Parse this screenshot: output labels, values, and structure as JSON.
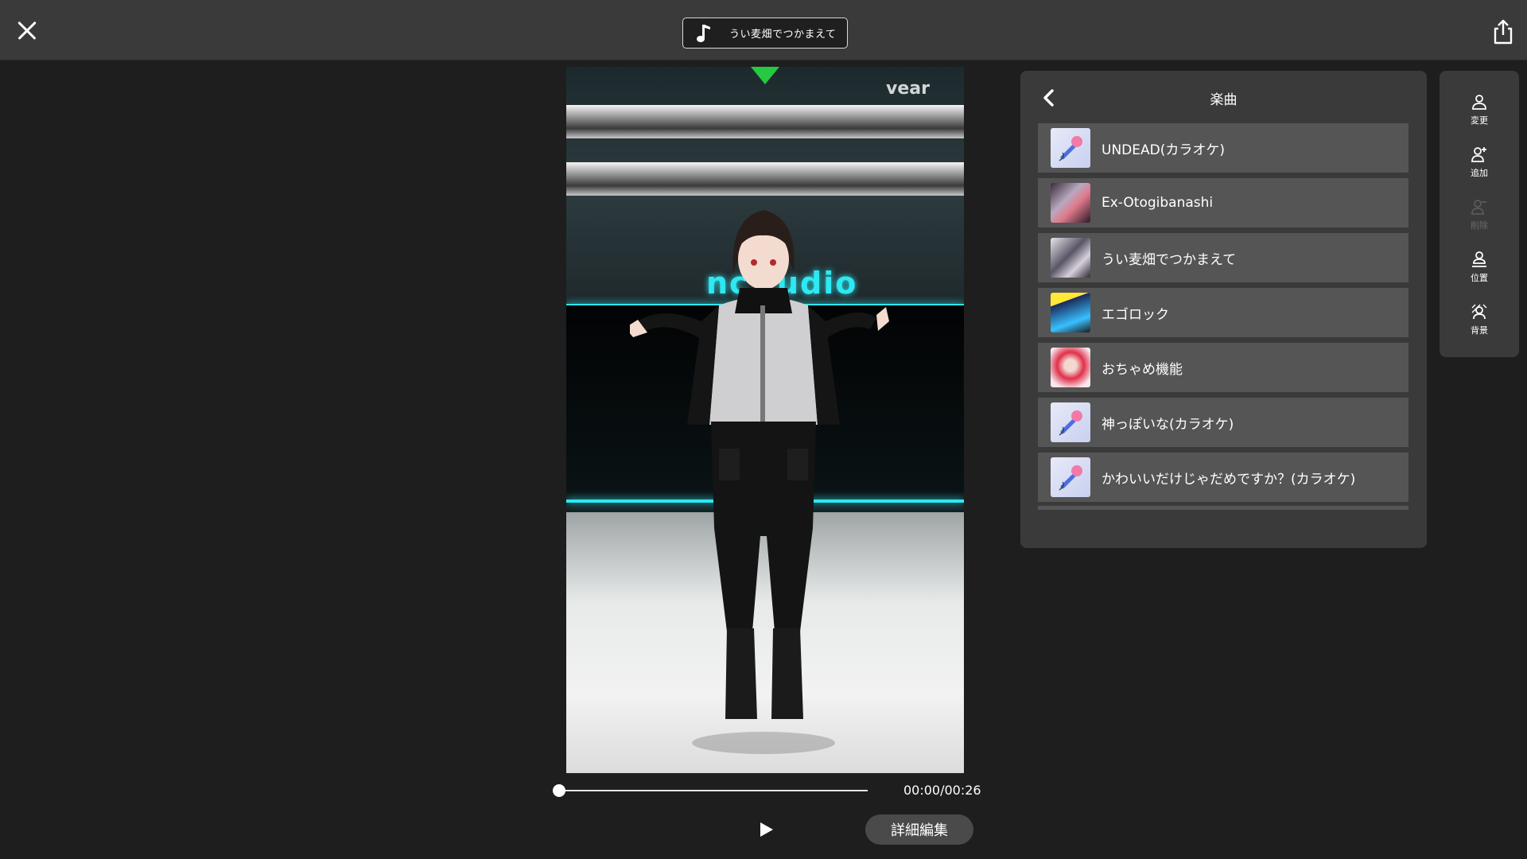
{
  "topbar": {
    "close_icon": "close-icon",
    "current_song": "うい麦畑でつかまえて",
    "music_icon": "music-note-icon",
    "share_icon": "share-icon"
  },
  "preview": {
    "scene_text": "nc  tudio",
    "watermark": "vear"
  },
  "playback": {
    "timecode": "00:00/00:26",
    "progress_fraction": 0,
    "play_icon": "play-icon",
    "detail_edit_label": "詳細編集"
  },
  "song_panel": {
    "title": "楽曲",
    "back_icon": "chevron-left-icon",
    "songs": [
      {
        "name": "UNDEAD(カラオケ)",
        "thumb": "microphone-icon"
      },
      {
        "name": "Ex-Otogibanashi",
        "thumb": "album-art"
      },
      {
        "name": "うい麦畑でつかまえて",
        "thumb": "album-art"
      },
      {
        "name": "エゴロック",
        "thumb": "album-art"
      },
      {
        "name": "おちゃめ機能",
        "thumb": "album-art"
      },
      {
        "name": "神っぽいな(カラオケ)",
        "thumb": "microphone-icon"
      },
      {
        "name": "かわいいだけじゃだめですか？(カラオケ)",
        "thumb": "microphone-icon"
      }
    ]
  },
  "toolbar": {
    "items": [
      {
        "label": "変更",
        "icon": "person-icon",
        "enabled": true
      },
      {
        "label": "追加",
        "icon": "person-add-icon",
        "enabled": true
      },
      {
        "label": "削除",
        "icon": "person-remove-icon",
        "enabled": false
      },
      {
        "label": "位置",
        "icon": "person-position-icon",
        "enabled": true
      },
      {
        "label": "背景",
        "icon": "background-icon",
        "enabled": true
      }
    ]
  },
  "colors": {
    "topbar_bg": "#3a3a3a",
    "panel_bg": "#3a3a3a",
    "item_bg": "#555555",
    "neon_accent": "#2ee8f2",
    "marker_green": "#26c93f"
  }
}
